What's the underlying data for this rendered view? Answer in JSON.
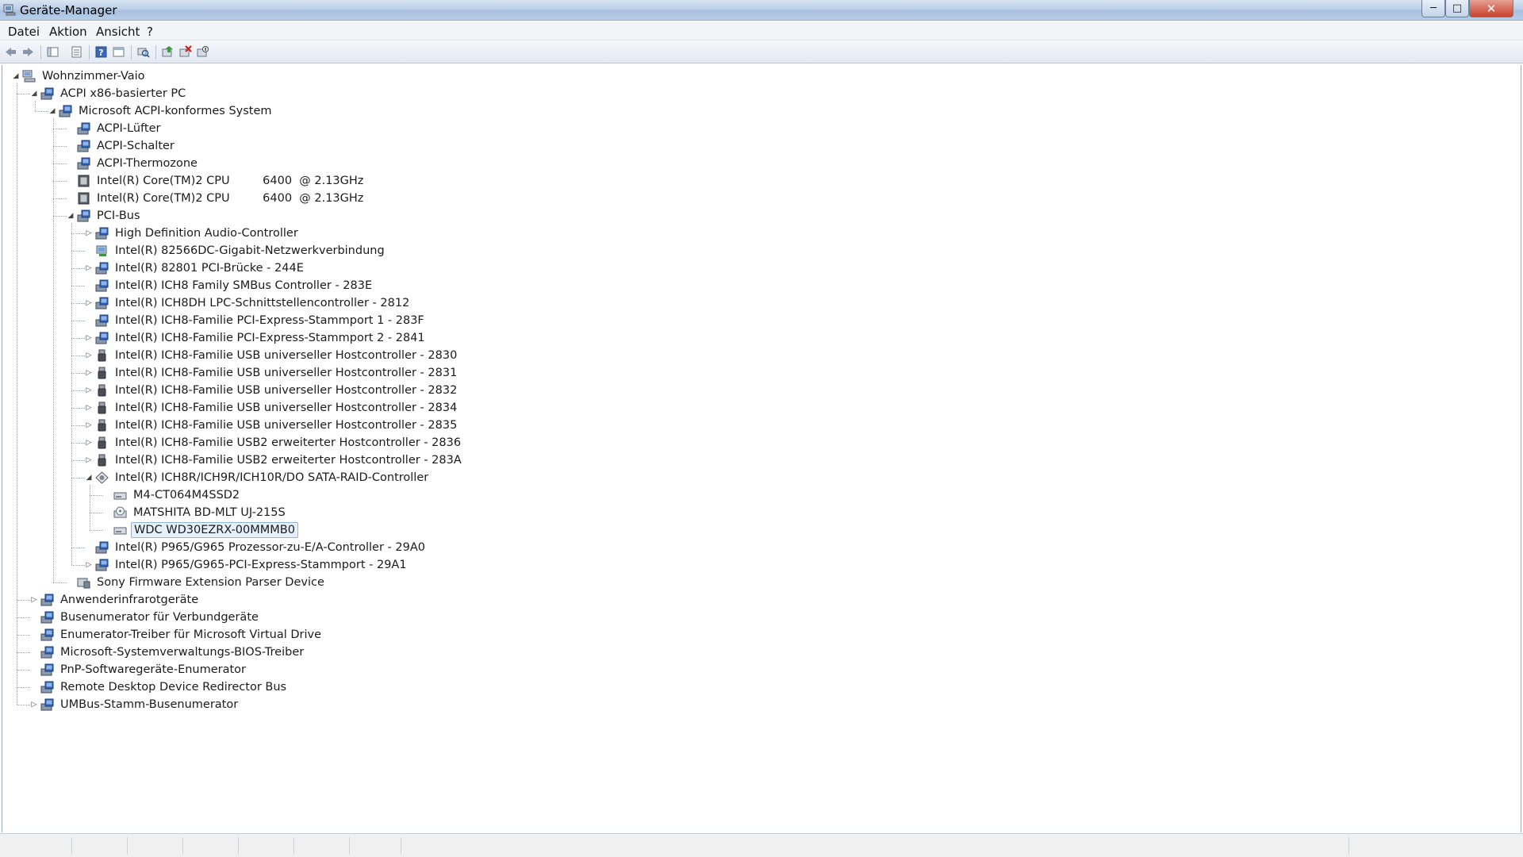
{
  "window": {
    "title": "Geräte-Manager"
  },
  "menu": [
    "Datei",
    "Aktion",
    "Ansicht",
    "?"
  ],
  "toolbar_icons": [
    "back-arrow-icon",
    "forward-arrow-icon",
    "show-hide-console-tree-icon",
    "properties-list-icon",
    "help-icon",
    "view-icon",
    "scan-hardware-icon",
    "update-driver-icon",
    "uninstall-icon",
    "disable-device-icon"
  ],
  "tree": [
    {
      "label": "Wohnzimmer-Vaio",
      "level": 0,
      "expander": "open",
      "icon": "computer"
    },
    {
      "label": "ACPI x86-basierter PC",
      "level": 1,
      "expander": "open",
      "icon": "system"
    },
    {
      "label": "Microsoft ACPI-konformes System",
      "level": 2,
      "expander": "open",
      "icon": "system"
    },
    {
      "label": "ACPI-Lüfter",
      "level": 3,
      "expander": "none",
      "icon": "system"
    },
    {
      "label": "ACPI-Schalter",
      "level": 3,
      "expander": "none",
      "icon": "system"
    },
    {
      "label": "ACPI-Thermozone",
      "level": 3,
      "expander": "none",
      "icon": "system"
    },
    {
      "label": "Intel(R) Core(TM)2 CPU         6400  @ 2.13GHz",
      "level": 3,
      "expander": "none",
      "icon": "cpu"
    },
    {
      "label": "Intel(R) Core(TM)2 CPU         6400  @ 2.13GHz",
      "level": 3,
      "expander": "none",
      "icon": "cpu"
    },
    {
      "label": "PCI-Bus",
      "level": 3,
      "expander": "open",
      "icon": "system"
    },
    {
      "label": "High Definition Audio-Controller",
      "level": 4,
      "expander": "closed",
      "icon": "system"
    },
    {
      "label": "Intel(R) 82566DC-Gigabit-Netzwerkverbindung",
      "level": 4,
      "expander": "none",
      "icon": "network"
    },
    {
      "label": "Intel(R) 82801 PCI-Brücke - 244E",
      "level": 4,
      "expander": "closed",
      "icon": "system"
    },
    {
      "label": "Intel(R) ICH8 Family SMBus Controller - 283E",
      "level": 4,
      "expander": "none",
      "icon": "system"
    },
    {
      "label": "Intel(R) ICH8DH LPC-Schnittstellencontroller - 2812",
      "level": 4,
      "expander": "closed",
      "icon": "system"
    },
    {
      "label": "Intel(R) ICH8-Familie PCI-Express-Stammport 1 - 283F",
      "level": 4,
      "expander": "none",
      "icon": "system"
    },
    {
      "label": "Intel(R) ICH8-Familie PCI-Express-Stammport 2 - 2841",
      "level": 4,
      "expander": "closed",
      "icon": "system"
    },
    {
      "label": "Intel(R) ICH8-Familie USB universeller Hostcontroller - 2830",
      "level": 4,
      "expander": "closed",
      "icon": "usb"
    },
    {
      "label": "Intel(R) ICH8-Familie USB universeller Hostcontroller - 2831",
      "level": 4,
      "expander": "closed",
      "icon": "usb"
    },
    {
      "label": "Intel(R) ICH8-Familie USB universeller Hostcontroller - 2832",
      "level": 4,
      "expander": "closed",
      "icon": "usb"
    },
    {
      "label": "Intel(R) ICH8-Familie USB universeller Hostcontroller - 2834",
      "level": 4,
      "expander": "closed",
      "icon": "usb"
    },
    {
      "label": "Intel(R) ICH8-Familie USB universeller Hostcontroller - 2835",
      "level": 4,
      "expander": "closed",
      "icon": "usb"
    },
    {
      "label": "Intel(R) ICH8-Familie USB2 erweiterter Hostcontroller - 2836",
      "level": 4,
      "expander": "closed",
      "icon": "usb"
    },
    {
      "label": "Intel(R) ICH8-Familie USB2 erweiterter Hostcontroller - 283A",
      "level": 4,
      "expander": "closed",
      "icon": "usb"
    },
    {
      "label": "Intel(R) ICH8R/ICH9R/ICH10R/DO SATA-RAID-Controller",
      "level": 4,
      "expander": "open",
      "icon": "storage"
    },
    {
      "label": "M4-CT064M4SSD2",
      "level": 5,
      "expander": "none",
      "icon": "disk"
    },
    {
      "label": "MATSHITA BD-MLT UJ-215S",
      "level": 5,
      "expander": "none",
      "icon": "optical"
    },
    {
      "label": "WDC WD30EZRX-00MMMB0",
      "level": 5,
      "expander": "none",
      "icon": "disk",
      "selected": true
    },
    {
      "label": "Intel(R) P965/G965 Prozessor-zu-E/A-Controller - 29A0",
      "level": 4,
      "expander": "none",
      "icon": "system"
    },
    {
      "label": "Intel(R) P965/G965-PCI-Express-Stammport - 29A1",
      "level": 4,
      "expander": "closed",
      "icon": "system"
    },
    {
      "label": "Sony Firmware Extension Parser Device",
      "level": 3,
      "expander": "none",
      "icon": "firmware"
    },
    {
      "label": "Anwenderinfrarotgeräte",
      "level": 1,
      "expander": "closed",
      "icon": "system"
    },
    {
      "label": "Busenumerator für Verbundgeräte",
      "level": 1,
      "expander": "none",
      "icon": "system"
    },
    {
      "label": "Enumerator-Treiber für Microsoft Virtual Drive",
      "level": 1,
      "expander": "none",
      "icon": "system"
    },
    {
      "label": "Microsoft-Systemverwaltungs-BIOS-Treiber",
      "level": 1,
      "expander": "none",
      "icon": "system"
    },
    {
      "label": "PnP-Softwaregeräte-Enumerator",
      "level": 1,
      "expander": "none",
      "icon": "system"
    },
    {
      "label": "Remote Desktop Device Redirector Bus",
      "level": 1,
      "expander": "none",
      "icon": "system"
    },
    {
      "label": "UMBus-Stamm-Busenumerator",
      "level": 1,
      "expander": "closed",
      "icon": "system"
    }
  ]
}
